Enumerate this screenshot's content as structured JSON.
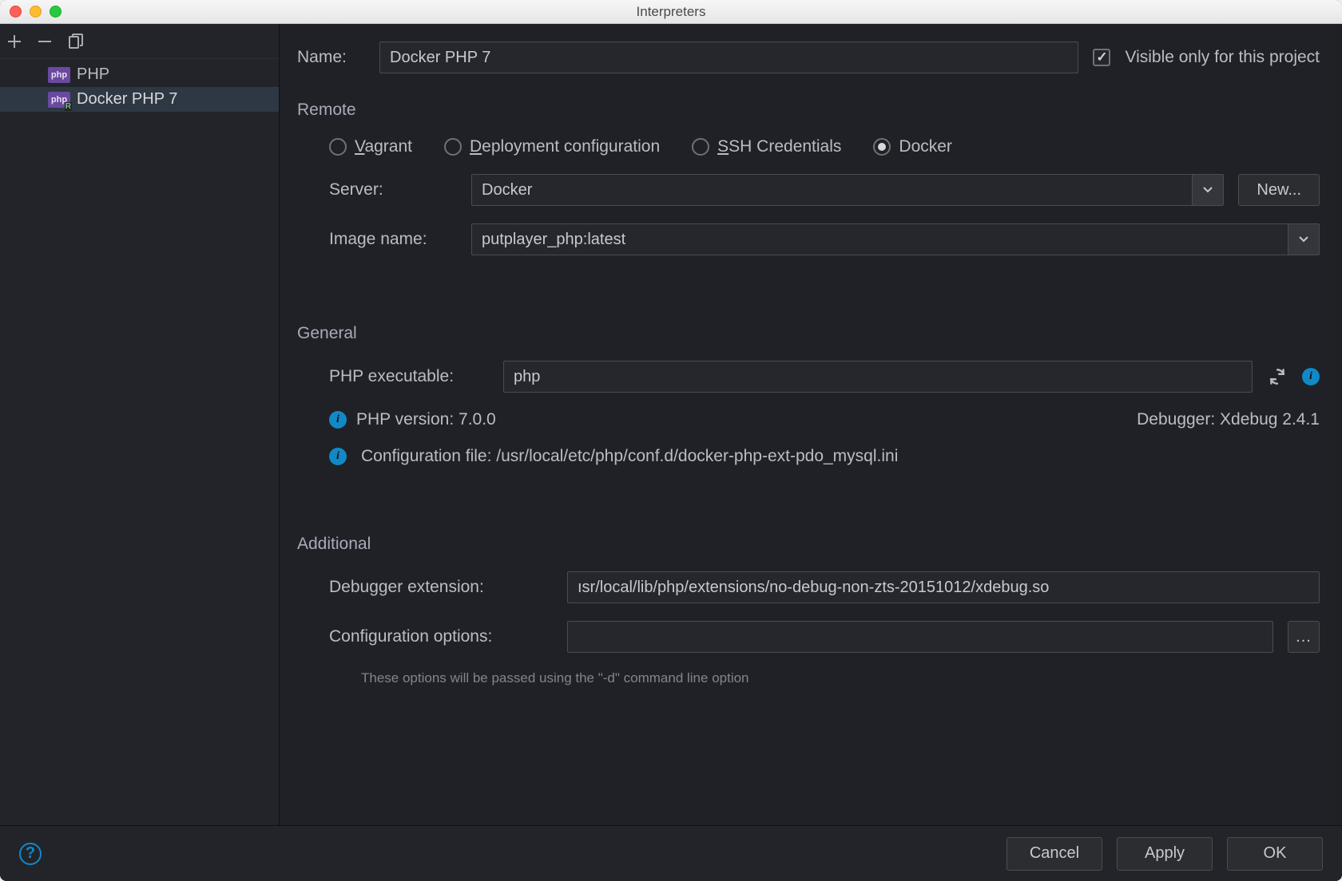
{
  "window": {
    "title": "Interpreters"
  },
  "sidebar": {
    "items": [
      {
        "label": "PHP",
        "remote": false
      },
      {
        "label": "Docker PHP 7",
        "remote": true
      }
    ],
    "selected_index": 1
  },
  "form": {
    "name_label": "Name:",
    "name_value": "Docker PHP 7",
    "visible_checkbox_label": "Visible only for this project",
    "visible_checked": true
  },
  "remote": {
    "section": "Remote",
    "options": {
      "vagrant": "Vagrant",
      "deployment": "Deployment configuration",
      "ssh": "SSH Credentials",
      "docker": "Docker"
    },
    "selected": "docker",
    "server_label": "Server:",
    "server_value": "Docker",
    "new_button": "New...",
    "image_label": "Image name:",
    "image_value": "putplayer_php:latest"
  },
  "general": {
    "section": "General",
    "executable_label": "PHP executable:",
    "executable_value": "php",
    "version_label": "PHP version:",
    "version_value": "7.0.0",
    "debugger_label": "Debugger:",
    "debugger_value": "Xdebug 2.4.1",
    "config_file_label": "Configuration file:",
    "config_file_value": "/usr/local/etc/php/conf.d/docker-php-ext-pdo_mysql.ini"
  },
  "additional": {
    "section": "Additional",
    "debugger_ext_label": "Debugger extension:",
    "debugger_ext_value": "ısr/local/lib/php/extensions/no-debug-non-zts-20151012/xdebug.so",
    "config_options_label": "Configuration options:",
    "config_options_value": "",
    "hint": "These options will be passed using the \"-d\" command line option"
  },
  "footer": {
    "cancel": "Cancel",
    "apply": "Apply",
    "ok": "OK"
  }
}
